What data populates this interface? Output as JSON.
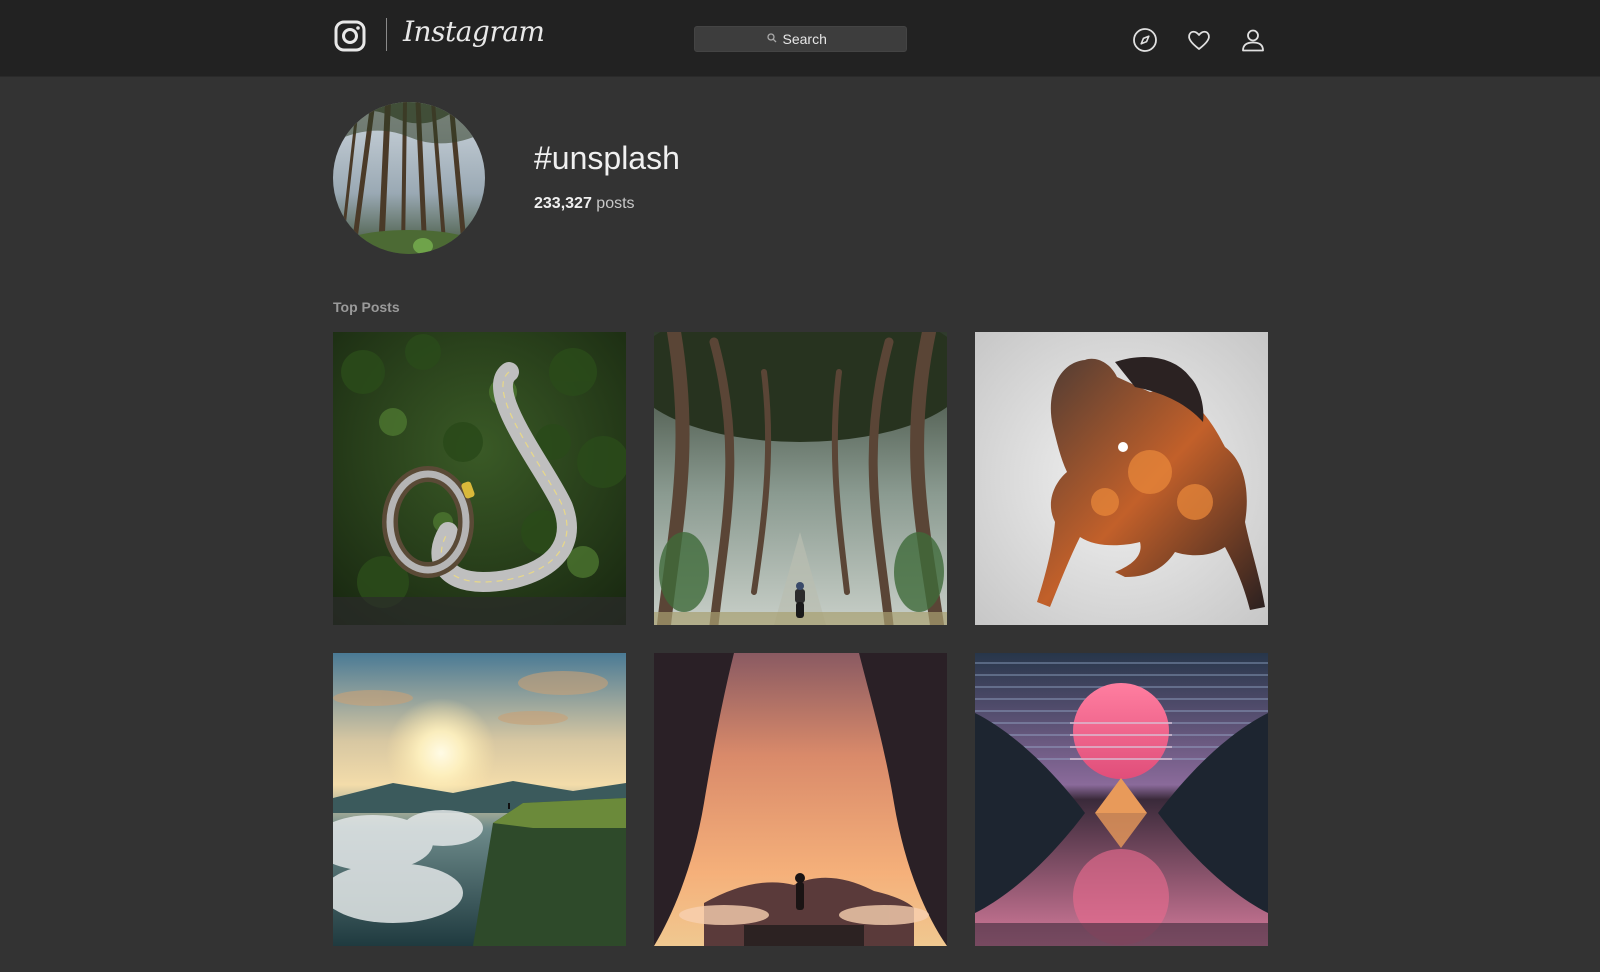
{
  "app": {
    "brand_name": "Instagram",
    "logo_icon": "instagram-camera-icon"
  },
  "search": {
    "placeholder": "Search",
    "icon": "search-icon"
  },
  "nav_icons": [
    {
      "name": "explore-compass-icon"
    },
    {
      "name": "activity-heart-icon"
    },
    {
      "name": "profile-person-icon"
    }
  ],
  "tag_header": {
    "hashtag": "#unsplash",
    "post_count": "233,327",
    "post_count_label": "posts",
    "avatar": "forest-tall-trees-photo"
  },
  "top_posts": {
    "title": "Top Posts",
    "items": [
      {
        "name": "winding-road-loop-photo"
      },
      {
        "name": "tree-tunnel-motorcycle-photo"
      },
      {
        "name": "horse-double-exposure-photo"
      },
      {
        "name": "sunrise-over-clouds-cliff-photo"
      },
      {
        "name": "cave-sunset-hiker-photo"
      },
      {
        "name": "retro-sun-mountain-reflection-photo"
      }
    ]
  },
  "colors": {
    "page_bg": "#333333",
    "topbar_bg": "#222222",
    "text_primary": "#f0f0f0",
    "text_muted": "#9a9a9a"
  }
}
